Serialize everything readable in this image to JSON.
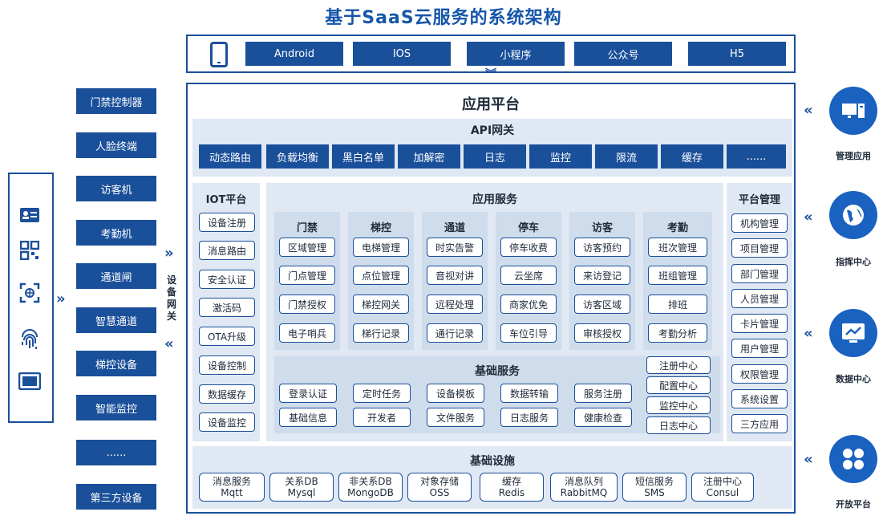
{
  "title": "基于SaaS云服务的系统架构",
  "clients": [
    "Android",
    "IOS",
    "小程序",
    "公众号",
    "H5"
  ],
  "main_title": "应用平台",
  "api_gateway": {
    "title": "API网关",
    "items": [
      "动态路由",
      "负载均衡",
      "黑白名单",
      "加解密",
      "日志",
      "监控",
      "限流",
      "缓存",
      "......"
    ]
  },
  "iot": {
    "title": "IOT平台",
    "items": [
      "设备注册",
      "消息路由",
      "安全认证",
      "激活码",
      "OTA升级",
      "设备控制",
      "数据缓存",
      "设备监控"
    ]
  },
  "app_services": {
    "title": "应用服务",
    "columns": [
      {
        "title": "门禁",
        "items": [
          "区域管理",
          "门点管理",
          "门禁授权",
          "电子哨兵"
        ]
      },
      {
        "title": "梯控",
        "items": [
          "电梯管理",
          "点位管理",
          "梯控网关",
          "梯行记录"
        ]
      },
      {
        "title": "通道",
        "items": [
          "时实告警",
          "音视对讲",
          "远程处理",
          "通行记录"
        ]
      },
      {
        "title": "停车",
        "items": [
          "停车收费",
          "云坐席",
          "商家优免",
          "车位引导"
        ]
      },
      {
        "title": "访客",
        "items": [
          "访客预约",
          "来访登记",
          "访客区域",
          "审核授权"
        ]
      },
      {
        "title": "考勤",
        "items": [
          "班次管理",
          "班组管理",
          "排班",
          "考勤分析"
        ]
      }
    ]
  },
  "base_services": {
    "title": "基础服务",
    "row1": [
      "登录认证",
      "定时任务",
      "设备模板",
      "数据转输",
      "服务注册"
    ],
    "row2": [
      "基础信息",
      "开发者",
      "文件服务",
      "日志服务",
      "健康检查"
    ],
    "side": [
      "注册中心",
      "配置中心",
      "监控中心",
      "日志中心"
    ]
  },
  "platform_mgmt": {
    "title": "平台管理",
    "items": [
      "机构管理",
      "项目管理",
      "部门管理",
      "人员管理",
      "卡片管理",
      "用户管理",
      "权限管理",
      "系统设置",
      "三方应用"
    ]
  },
  "infra": {
    "title": "基础设施",
    "items": [
      {
        "l1": "消息服务",
        "l2": "Mqtt"
      },
      {
        "l1": "关系DB",
        "l2": "Mysql"
      },
      {
        "l1": "非关系DB",
        "l2": "MongoDB"
      },
      {
        "l1": "对象存储",
        "l2": "OSS"
      },
      {
        "l1": "缓存",
        "l2": "Redis"
      },
      {
        "l1": "消息队列",
        "l2": "RabbitMQ"
      },
      {
        "l1": "短信服务",
        "l2": "SMS"
      },
      {
        "l1": "注册中心",
        "l2": "Consul"
      }
    ]
  },
  "devices": [
    "门禁控制器",
    "人脸终端",
    "访客机",
    "考勤机",
    "通道闸",
    "智慧通道",
    "梯控设备",
    "智能监控",
    "......",
    "第三方设备"
  ],
  "gateway_label": "设备网关",
  "right": [
    "管理应用",
    "指挥中心",
    "数据中心",
    "开放平台"
  ],
  "colors": {
    "primary": "#1a4f9a",
    "panel": "#dfe8f3",
    "column": "#cfdcec",
    "icon_bg": "#1a62c0"
  }
}
